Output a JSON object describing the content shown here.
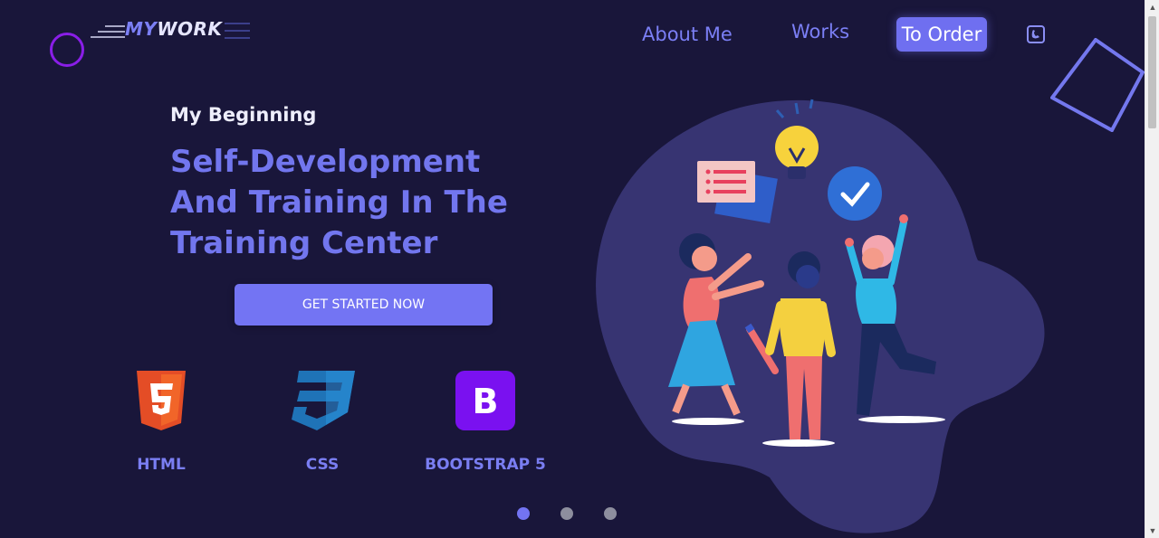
{
  "header": {
    "logo_part1": "MY",
    "logo_part2": "WORK",
    "nav": {
      "about": "About Me",
      "works": "Works",
      "order": "To Order"
    }
  },
  "hero": {
    "eyebrow": "My Beginning",
    "title_lines": [
      "Self-Development",
      "And Training In The",
      "Training Center"
    ],
    "cta": "GET STARTED NOW"
  },
  "tech": [
    {
      "label": "HTML",
      "icon": "html5-icon"
    },
    {
      "label": "CSS",
      "icon": "css3-icon"
    },
    {
      "label": "BOOTSTRAP 5",
      "icon": "bootstrap-icon"
    }
  ],
  "carousel": {
    "slides": 3,
    "active": 1
  },
  "colors": {
    "background": "#19163a",
    "accent": "#7374f3",
    "logo_circle": "#8a1ee8",
    "html_orange": "#e44d26",
    "css_blue": "#1f73b7",
    "bootstrap_purple": "#7a11f0"
  }
}
